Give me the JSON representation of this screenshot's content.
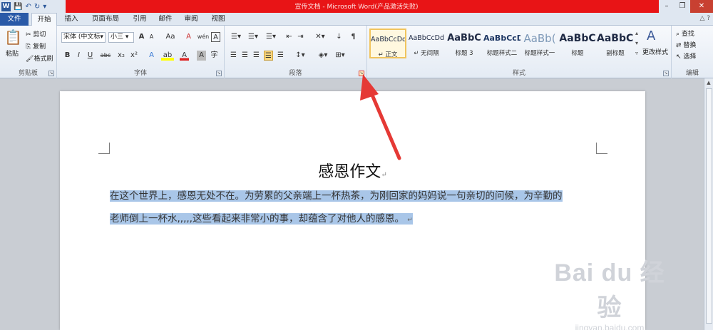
{
  "titlebar": {
    "title": "宣传文档 - Microsoft Word(产品激活失败)",
    "qat_icons": [
      "word-logo-icon",
      "save-icon",
      "undo-icon",
      "redo-icon",
      "customize-icon"
    ],
    "controls": [
      "minimize",
      "restore",
      "close"
    ]
  },
  "tabs": [
    "文件",
    "开始",
    "插入",
    "页面布局",
    "引用",
    "邮件",
    "审阅",
    "视图"
  ],
  "active_tab": "开始",
  "ribbon": {
    "clipboard": {
      "paste_label": "粘贴",
      "cut_label": "剪切",
      "copy_label": "复制",
      "format_painter_label": "格式刷",
      "group_label": "剪贴板"
    },
    "font": {
      "font_name": "宋体 (中文标▾",
      "font_size": "小三",
      "group_label": "字体",
      "grow": "A",
      "shrink": "A",
      "change_case": "Aa",
      "clear_format": "A",
      "phonetic": "wén",
      "bold": "B",
      "italic": "I",
      "underline": "U",
      "strike": "abc",
      "subscript": "x₂",
      "superscript": "x²",
      "text_effect": "A",
      "highlight": "ab",
      "font_color": "A",
      "char_shading": "A",
      "enclose": "字"
    },
    "paragraph": {
      "group_label": "段落"
    },
    "styles": {
      "group_label": "样式",
      "items": [
        {
          "preview": "AaBbCcDd",
          "name": "↵ 正文"
        },
        {
          "preview": "AaBbCcDd",
          "name": "↵ 无间隔"
        },
        {
          "preview": "AaBbC",
          "name": "标题 3"
        },
        {
          "preview": "AaBbCcD",
          "name": "标题样式二"
        },
        {
          "preview": "AaBb(",
          "name": "标题样式一"
        },
        {
          "preview": "AaBbC",
          "name": "标题"
        },
        {
          "preview": "AaBbC(",
          "name": "副标题"
        }
      ],
      "change_styles_label": "更改样式"
    },
    "editing": {
      "group_label": "编辑",
      "find_label": "查找",
      "replace_label": "替换",
      "select_label": "选择"
    }
  },
  "document": {
    "title": "感恩作文",
    "para_line1": "在这个世界上，感恩无处不在。为劳累的父亲端上一杯热茶，为刚回家的妈妈说一句亲切的问候，为辛勤的",
    "para_line2": "老师倒上一杯水,,,,,这些看起来非常小的事，却蕴含了对他人的感恩。",
    "para_mark": "↵"
  },
  "watermark": {
    "main": "Bai du 经验",
    "sub": "jingyan.baidu.com"
  },
  "colors": {
    "titlebar": "#e81416",
    "file_tab": "#2a5aa8",
    "selection": "#a9c6e8",
    "arrow": "#e53935"
  }
}
